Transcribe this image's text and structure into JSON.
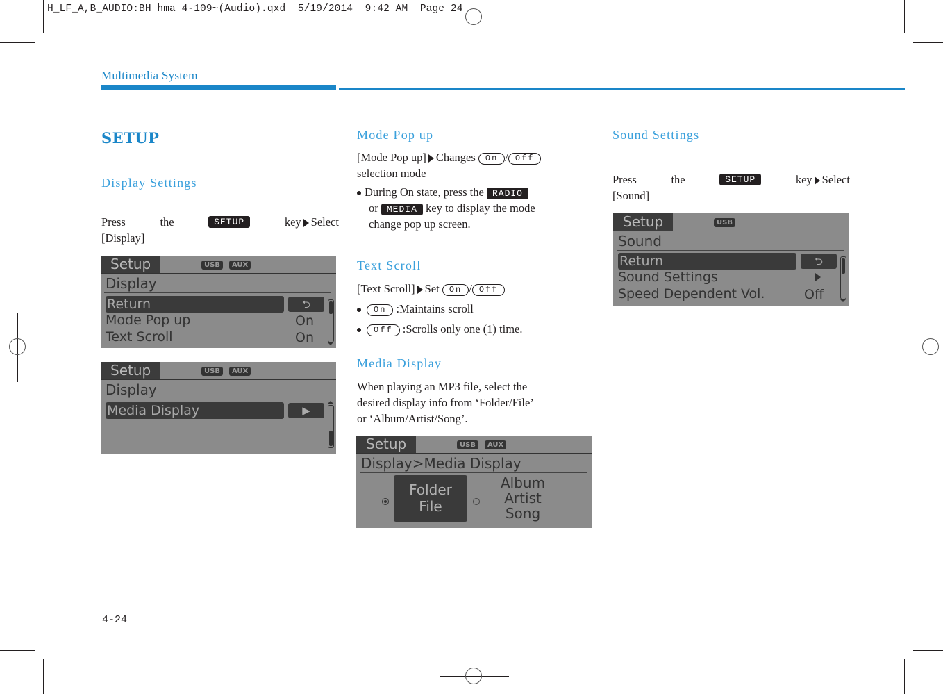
{
  "slug": "H_LF_A,B_AUDIO:BH hma 4-109~(Audio).qxd  5/19/2014  9:42 AM  Page 24",
  "header": {
    "section_title": "Multimedia System"
  },
  "colors": {
    "accent": "#1a86c8",
    "subheading": "#3aa0dc",
    "lcd_bg": "#8b8b8b",
    "lcd_dark": "#3a3a3a"
  },
  "col1": {
    "title": "SETUP",
    "display_settings": {
      "heading": "Display Settings",
      "instr": {
        "press": "Press",
        "the": "the",
        "key_label": "SETUP",
        "key_word": "key",
        "select": "Select",
        "target": "[Display]"
      }
    },
    "screen1": {
      "tab": "Setup",
      "badges": [
        "USB",
        "AUX"
      ],
      "crumb": "Display",
      "rows": [
        {
          "label": "Return",
          "value": "⮌",
          "selected": true
        },
        {
          "label": "Mode Pop up",
          "value": "On"
        },
        {
          "label": "Text Scroll",
          "value": "On"
        }
      ]
    },
    "screen2": {
      "tab": "Setup",
      "badges": [
        "USB",
        "AUX"
      ],
      "crumb": "Display",
      "rows": [
        {
          "label": "Media Display",
          "value": "▶",
          "selected": true
        }
      ]
    }
  },
  "col2": {
    "mode_popup": {
      "heading": "Mode Pop up",
      "line1_item": "[Mode Pop up]",
      "line1_action": "Changes",
      "on": "On",
      "off": "Off",
      "slash": "/",
      "line2": "selection mode",
      "bullet_pre": "During On state, press the",
      "key_radio": "RADIO",
      "bullet_or": "or",
      "key_media": "MEDIA",
      "bullet_post": "key to display the mode",
      "bullet_line3": "change pop up screen."
    },
    "text_scroll": {
      "heading": "Text Scroll",
      "line1_item": "[Text Scroll]",
      "line1_action": "Set",
      "on": "On",
      "off": "Off",
      "slash": "/",
      "bullets": [
        {
          "pill": "On",
          "text": ":Maintains scroll"
        },
        {
          "pill": "Off",
          "text": ":Scrolls only one (1) time."
        }
      ]
    },
    "media_display": {
      "heading": "Media Display",
      "lines": [
        "When playing an MP3 file, select the",
        "desired display info from ‘Folder/File’",
        "or ‘Album/Artist/Song’."
      ]
    },
    "screen3": {
      "tab": "Setup",
      "badges": [
        "USB",
        "AUX"
      ],
      "crumb": "Display>Media Display",
      "option1": {
        "line1": "Folder",
        "line2": "File",
        "selected": true
      },
      "option2": {
        "line1": "Album",
        "line2": "Artist",
        "line3": "Song",
        "selected": false
      }
    }
  },
  "col3": {
    "sound_settings": {
      "heading": "Sound Settings",
      "instr": {
        "press": "Press",
        "the": "the",
        "key_label": "SETUP",
        "key_word": "key",
        "select": "Select",
        "target": "[Sound]"
      }
    },
    "screen4": {
      "tab": "Setup",
      "badges": [
        "USB"
      ],
      "crumb": "Sound",
      "rows": [
        {
          "label": "Return",
          "value": "⮌",
          "selected": true
        },
        {
          "label": "Sound Settings",
          "value": "▶"
        },
        {
          "label": "Speed Dependent Vol.",
          "value": "Off"
        }
      ]
    }
  },
  "footer": {
    "page_number": "4-24"
  }
}
